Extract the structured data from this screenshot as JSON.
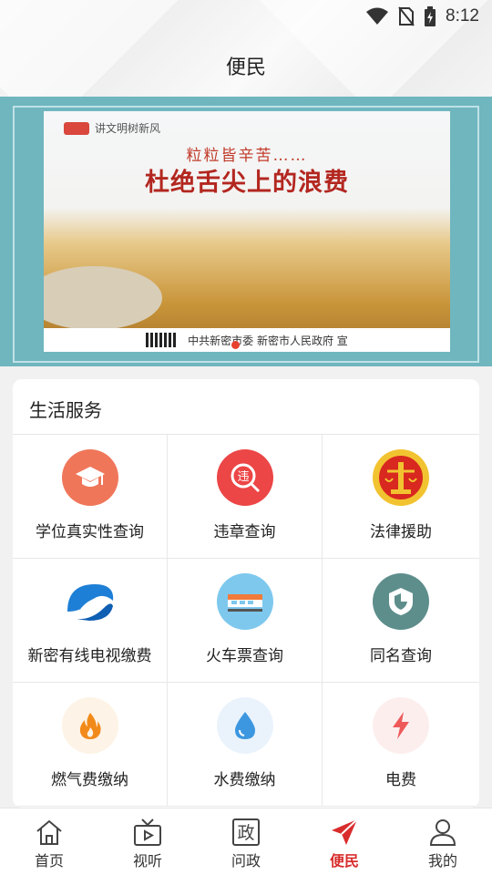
{
  "status": {
    "time": "8:12"
  },
  "header": {
    "title": "便民"
  },
  "banner": {
    "logo_text": "讲文明树新风",
    "subtitle": "粒粒皆辛苦……",
    "headline": "杜绝舌尖上的浪费",
    "footer_text": "中共新密市委 新密市人民政府 宣"
  },
  "services": {
    "title": "生活服务",
    "items": [
      {
        "label": "学位真实性查询",
        "icon": "graduation-cap-icon",
        "color": "#f0765a"
      },
      {
        "label": "违章查询",
        "icon": "violation-icon",
        "color": "#ec4646"
      },
      {
        "label": "法律援助",
        "icon": "court-emblem-icon",
        "color": "#d8281f"
      },
      {
        "label": "新密有线电视缴费",
        "icon": "cable-tv-logo-icon",
        "color": "#1e7fd6"
      },
      {
        "label": "火车票查询",
        "icon": "train-icon",
        "color": "#7ec8ee"
      },
      {
        "label": "同名查询",
        "icon": "shield-icon",
        "color": "#5d8e8c"
      },
      {
        "label": "燃气费缴纳",
        "icon": "flame-icon",
        "color": "#fdf3e6"
      },
      {
        "label": "水费缴纳",
        "icon": "water-drop-icon",
        "color": "#eaf3fc"
      },
      {
        "label": "电费",
        "icon": "lightning-icon",
        "color": "#fdeeee"
      }
    ]
  },
  "tabs": [
    {
      "label": "首页",
      "icon": "home-icon"
    },
    {
      "label": "视听",
      "icon": "tv-icon"
    },
    {
      "label": "问政",
      "icon": "government-icon",
      "glyph": "政"
    },
    {
      "label": "便民",
      "icon": "paper-plane-icon"
    },
    {
      "label": "我的",
      "icon": "person-icon"
    }
  ],
  "accent_color": "#d92d2d"
}
